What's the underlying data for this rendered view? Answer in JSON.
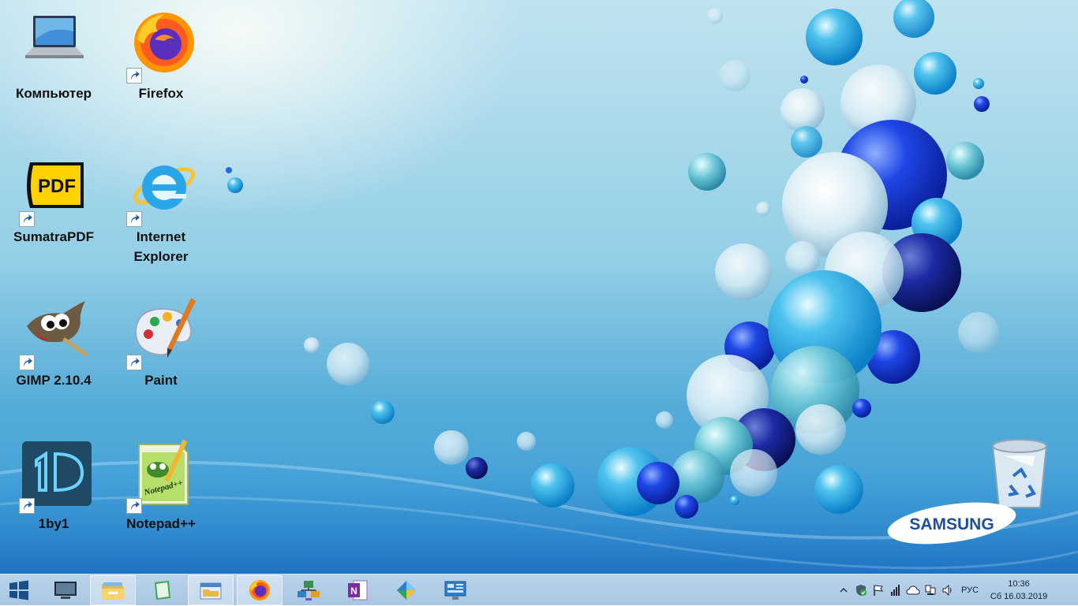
{
  "desktop": {
    "icons": [
      {
        "label": "Компьютер",
        "icon": "laptop-icon",
        "shortcut": false
      },
      {
        "label": "Firefox",
        "icon": "firefox-icon",
        "shortcut": true
      },
      {
        "label": "SumatraPDF",
        "icon": "pdf-icon",
        "shortcut": true
      },
      {
        "label": "Internet\nExplorer",
        "icon": "internet-explorer-icon",
        "shortcut": true
      },
      {
        "label": "GIMP 2.10.4",
        "icon": "gimp-icon",
        "shortcut": true
      },
      {
        "label": "Paint",
        "icon": "paint-palette-icon",
        "shortcut": true
      },
      {
        "label": "1by1",
        "icon": "1by1-player-icon",
        "shortcut": true
      },
      {
        "label": "Notepad++",
        "icon": "notepad-plus-plus-icon",
        "shortcut": true
      }
    ],
    "recycle_bin": {
      "icon": "recycle-bin-icon"
    },
    "brand_logo": "SAMSUNG"
  },
  "taskbar": {
    "start": {
      "icon": "windows-start-icon"
    },
    "pinned": [
      {
        "icon": "show-desktop-icon",
        "active": false
      },
      {
        "icon": "file-explorer-icon",
        "active": true
      },
      {
        "icon": "green-book-icon",
        "active": false
      },
      {
        "icon": "folder-window-icon",
        "active": true
      },
      {
        "icon": "firefox-icon",
        "active": true
      },
      {
        "icon": "network-computers-icon",
        "active": false
      },
      {
        "icon": "onenote-icon",
        "active": false
      },
      {
        "icon": "diamond-app-icon",
        "active": false
      },
      {
        "icon": "control-panel-icon",
        "active": false
      }
    ],
    "tray": {
      "icons": [
        "chevron-up-icon",
        "security-shield-icon",
        "flag-icon",
        "signal-icon",
        "onedrive-cloud-icon",
        "network-icon",
        "volume-icon"
      ],
      "language": "РУС",
      "time": "10:36",
      "date": "Сб 16.03.2019"
    }
  },
  "colors": {
    "taskbar": "#b2cde6",
    "accent_blue": "#1e6fd9"
  }
}
